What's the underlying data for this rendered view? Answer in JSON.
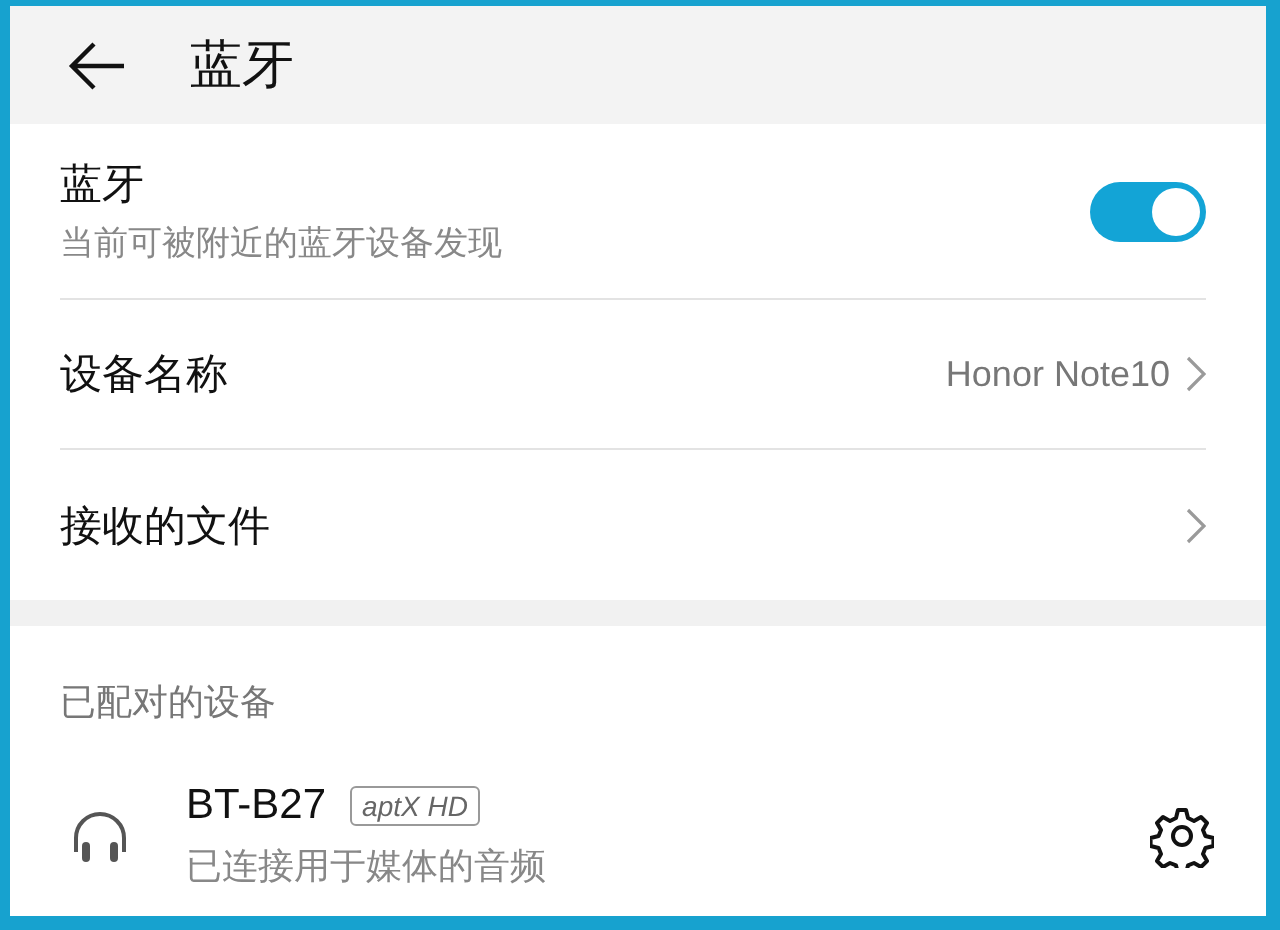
{
  "header": {
    "title": "蓝牙"
  },
  "settings": [
    {
      "kind": "toggle",
      "label": "蓝牙",
      "subtitle": "当前可被附近的蓝牙设备发现",
      "on": true
    },
    {
      "kind": "link",
      "label": "设备名称",
      "value": "Honor Note10"
    },
    {
      "kind": "link",
      "label": "接收的文件"
    }
  ],
  "paired": {
    "heading": "已配对的设备",
    "devices": [
      {
        "name": "BT-B27",
        "badge": "aptX HD",
        "status": "已连接用于媒体的音频"
      }
    ]
  }
}
